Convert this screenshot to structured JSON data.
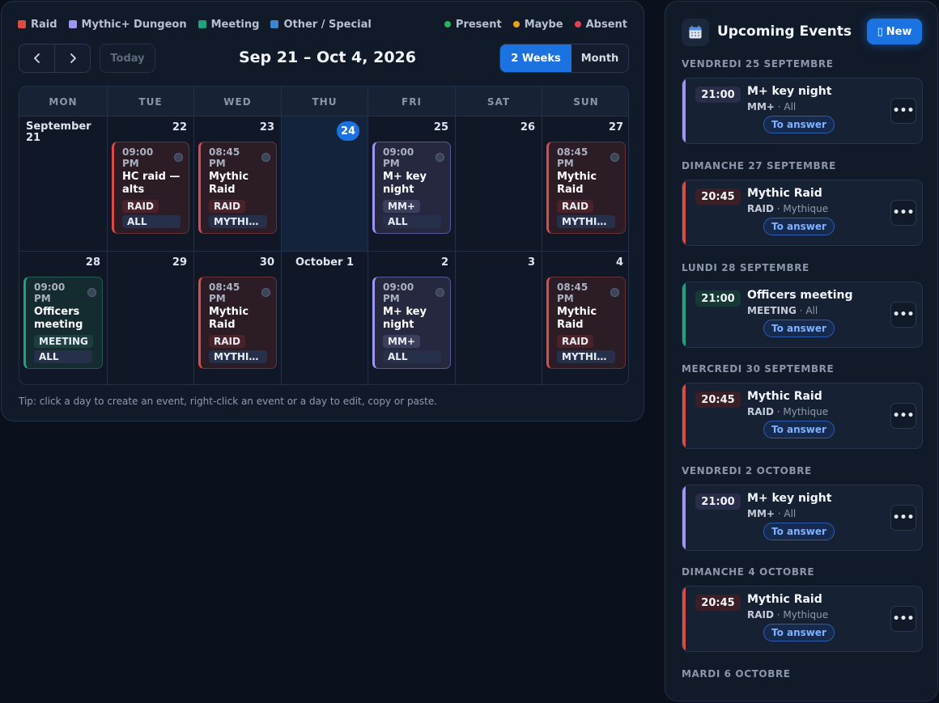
{
  "legend": {
    "categories": [
      {
        "label": "Raid",
        "color": "#dc4b44"
      },
      {
        "label": "Mythic+ Dungeon",
        "color": "#9e96f0"
      },
      {
        "label": "Meeting",
        "color": "#21a27c"
      },
      {
        "label": "Other / Special",
        "color": "#3a86d0"
      }
    ],
    "statuses": [
      {
        "label": "Present",
        "color": "#27b45a"
      },
      {
        "label": "Maybe",
        "color": "#e8a317"
      },
      {
        "label": "Absent",
        "color": "#e0454d"
      }
    ]
  },
  "toolbar": {
    "today_label": "Today",
    "range_title": "Sep 21 – Oct 4, 2026",
    "view_two_weeks": "2 Weeks",
    "view_month": "Month"
  },
  "calendar": {
    "weekdays": [
      "MON",
      "TUE",
      "WED",
      "THU",
      "FRI",
      "SAT",
      "SUN"
    ],
    "week1": [
      {
        "day": "September 21"
      },
      {
        "day": "22",
        "event": {
          "time": "09:00 PM",
          "name": "HC raid — alts",
          "tag1": "RAID",
          "tag2": "ALL"
        }
      },
      {
        "day": "23",
        "event": {
          "time": "08:45 PM",
          "name": "Mythic Raid",
          "tag1": "RAID",
          "tag2": "MYTHI…"
        }
      },
      {
        "day": "24"
      },
      {
        "day": "25",
        "event": {
          "time": "09:00 PM",
          "name": "M+ key night",
          "tag1": "MM+",
          "tag2": "ALL"
        }
      },
      {
        "day": "26"
      },
      {
        "day": "27",
        "event": {
          "time": "08:45 PM",
          "name": "Mythic Raid",
          "tag1": "RAID",
          "tag2": "MYTHIQ…"
        }
      }
    ],
    "week2": [
      {
        "day": "28",
        "event": {
          "time": "09:00 PM",
          "name": "Officers meeting",
          "tag1": "MEETING",
          "tag2": "ALL"
        }
      },
      {
        "day": "29"
      },
      {
        "day": "30",
        "event": {
          "time": "08:45 PM",
          "name": "Mythic Raid",
          "tag1": "RAID",
          "tag2": "MYTHI…"
        }
      },
      {
        "day": "October 1"
      },
      {
        "day": "2",
        "event": {
          "time": "09:00 PM",
          "name": "M+ key night",
          "tag1": "MM+",
          "tag2": "ALL"
        }
      },
      {
        "day": "3"
      },
      {
        "day": "4",
        "event": {
          "time": "08:45 PM",
          "name": "Mythic Raid",
          "tag1": "RAID",
          "tag2": "MYTHIQ…"
        }
      }
    ],
    "tip": "Tip: click a day to create an event, right-click an event or a day to edit, copy or paste."
  },
  "upcoming": {
    "title": "Upcoming Events",
    "new_label": "New",
    "groups": [
      {
        "date": "VENDREDI 25 SEPTEMBRE",
        "time": "21:00",
        "title": "M+ key night",
        "type": "MM+",
        "audience": " · All",
        "answer": "To answer",
        "kind": "mm"
      },
      {
        "date": "DIMANCHE 27 SEPTEMBRE",
        "time": "20:45",
        "title": "Mythic Raid",
        "type": "RAID",
        "audience": " · Mythique",
        "answer": "To answer",
        "kind": "raid"
      },
      {
        "date": "LUNDI 28 SEPTEMBRE",
        "time": "21:00",
        "title": "Officers meeting",
        "type": "MEETING",
        "audience": " · All",
        "answer": "To answer",
        "kind": "meet"
      },
      {
        "date": "MERCREDI 30 SEPTEMBRE",
        "time": "20:45",
        "title": "Mythic Raid",
        "type": "RAID",
        "audience": " · Mythique",
        "answer": "To answer",
        "kind": "raid"
      },
      {
        "date": "VENDREDI 2 OCTOBRE",
        "time": "21:00",
        "title": "M+ key night",
        "type": "MM+",
        "audience": " · All",
        "answer": "To answer",
        "kind": "mm"
      },
      {
        "date": "DIMANCHE 4 OCTOBRE",
        "time": "20:45",
        "title": "Mythic Raid",
        "type": "RAID",
        "audience": " · Mythique",
        "answer": "To answer",
        "kind": "raid"
      }
    ],
    "last_date": "MARDI 6 OCTOBRE"
  }
}
